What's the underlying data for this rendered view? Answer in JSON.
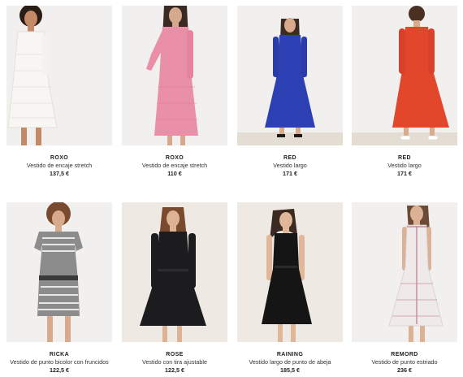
{
  "products": [
    {
      "name": "ROXO",
      "desc": "Vestido de encaje stretch",
      "price": "137,5 €",
      "dress_color": "#f7f6f2"
    },
    {
      "name": "ROXO",
      "desc": "Vestido de encaje stretch",
      "price": "110 €",
      "dress_color": "#ea8fa8"
    },
    {
      "name": "RED",
      "desc": "Vestido largo",
      "price": "171 €",
      "dress_color": "#2c3fb3"
    },
    {
      "name": "RED",
      "desc": "Vestido largo",
      "price": "171 €",
      "dress_color": "#e2472c"
    },
    {
      "name": "RICKA",
      "desc": "Vestido de punto bicolor con fruncidos",
      "price": "122,5 €",
      "dress_color": "#8c8c8c"
    },
    {
      "name": "ROSE",
      "desc": "Vestido con tira ajustable",
      "price": "122,5 €",
      "dress_color": "#1c1c1e"
    },
    {
      "name": "RAINING",
      "desc": "Vestido largo de punto de abeja",
      "price": "185,5 €",
      "dress_color": "#151515"
    },
    {
      "name": "REMORD",
      "desc": "Vestido de punto estriado",
      "price": "236 €",
      "dress_color": "#efe9ea"
    }
  ]
}
